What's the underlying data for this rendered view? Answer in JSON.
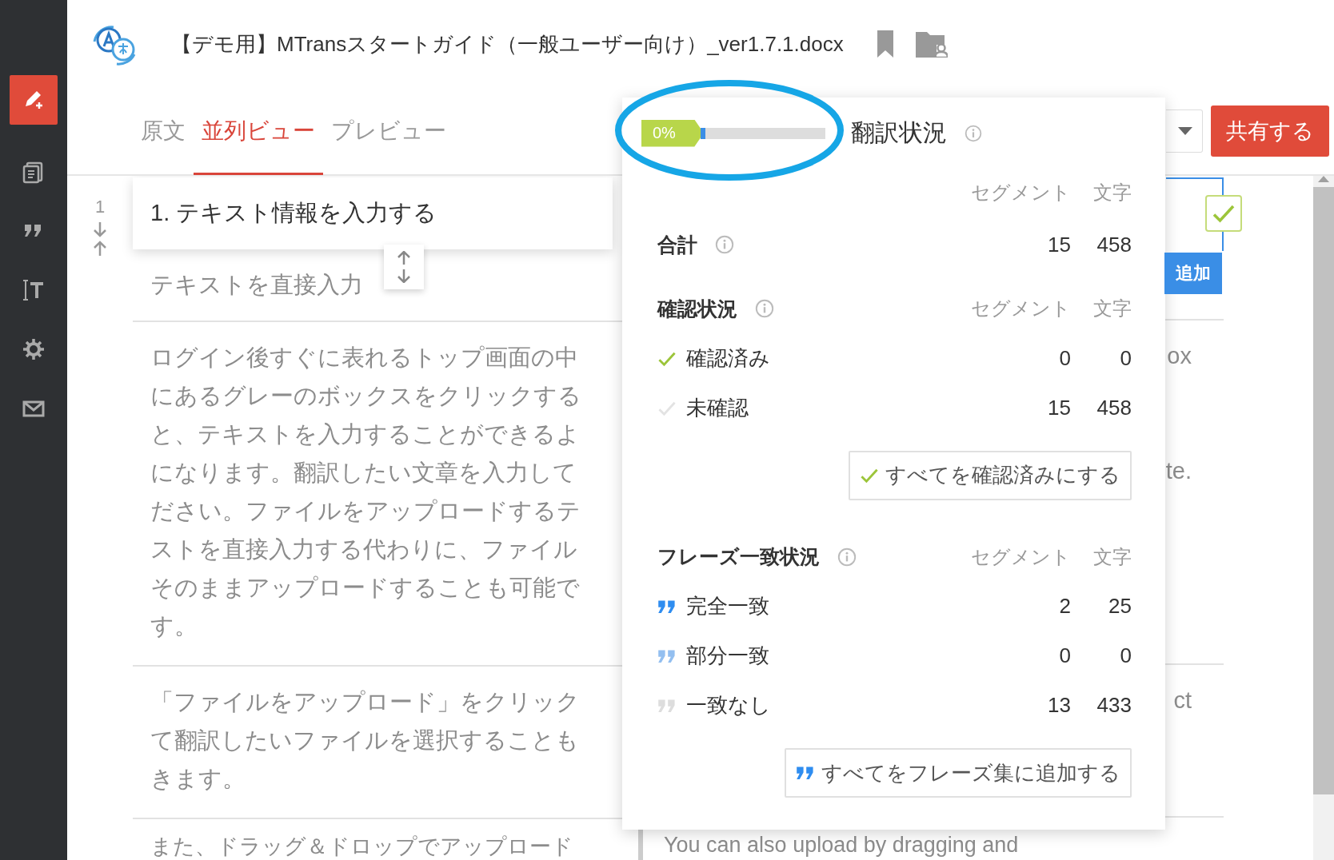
{
  "sidebar": {
    "items": [
      {
        "selected": true
      },
      {
        "selected": false
      },
      {
        "selected": false
      },
      {
        "selected": false
      },
      {
        "selected": false
      },
      {
        "selected": false
      }
    ]
  },
  "document": {
    "title": "【デモ用】MTransスタートガイド（一般ユーザー向け）_ver1.7.1.docx"
  },
  "tabs": [
    {
      "label": "原文",
      "selected": false
    },
    {
      "label": "並列ビュー",
      "selected": true
    },
    {
      "label": "プレビュー",
      "selected": false
    }
  ],
  "share_button": "共有する",
  "editor": {
    "segment_number": "1",
    "heading": "1. テキスト情報を入力する",
    "add_button": "追加",
    "confirm_checkbox": {
      "checked": true
    },
    "rows": [
      {
        "source_lines": [
          "テキストを直接入力"
        ],
        "target_lines": []
      },
      {
        "source_lines": [
          "ログイン後すぐに表れるトップ画面の中",
          "にあるグレーのボックスをクリックする",
          "と、テキストを入力することができるよ",
          "になります。翻訳したい文章を入力して",
          "ださい。ファイルをアップロードするテ",
          "ストを直接入力する代わりに、ファイル",
          "そのままアップロードすることも可能で",
          "す。"
        ],
        "target_lines": [
          {
            "kind": "text",
            "text": "ox"
          },
          {
            "kind": "blank"
          },
          {
            "kind": "blank"
          },
          {
            "kind": "text",
            "text": "te."
          }
        ]
      },
      {
        "source_lines": [
          "「ファイルをアップロード」をクリック",
          "て翻訳したいファイルを選択することも",
          "きます。"
        ],
        "target_lines": [
          {
            "kind": "text",
            "text": "ct"
          }
        ]
      },
      {
        "source_lines": [
          "また、ドラッグ＆ドロップでアップロード"
        ],
        "target_lines": [
          {
            "kind": "text",
            "text": "You can also upload by dragging and"
          }
        ]
      }
    ]
  },
  "status_panel": {
    "title": "翻訳状況",
    "progress": {
      "label": "0%",
      "level": 0.04
    },
    "total": {
      "column_headers": [
        "セグメント",
        "文字"
      ],
      "label": "合計",
      "segments": "15",
      "characters": "458"
    },
    "review": {
      "title": "確認状況",
      "column_headers": [
        "セグメント",
        "文字"
      ],
      "rows": [
        {
          "label": "確認済み",
          "segments": "0",
          "characters": "0",
          "checked": true
        },
        {
          "label": "未確認",
          "segments": "15",
          "characters": "458",
          "checked": false
        }
      ],
      "button": "すべてを確認済みにする"
    },
    "phrase_match": {
      "title": "フレーズ一致状況",
      "column_headers": [
        "セグメント",
        "文字"
      ],
      "rows": [
        {
          "label": "完全一致",
          "segments": "2",
          "characters": "25",
          "color": "#2f8df0"
        },
        {
          "label": "部分一致",
          "segments": "0",
          "characters": "0",
          "color": "#93bff0"
        },
        {
          "label": "一致なし",
          "segments": "13",
          "characters": "433",
          "color": "#dddddd"
        }
      ],
      "button": "すべてをフレーズ集に追加する"
    }
  }
}
